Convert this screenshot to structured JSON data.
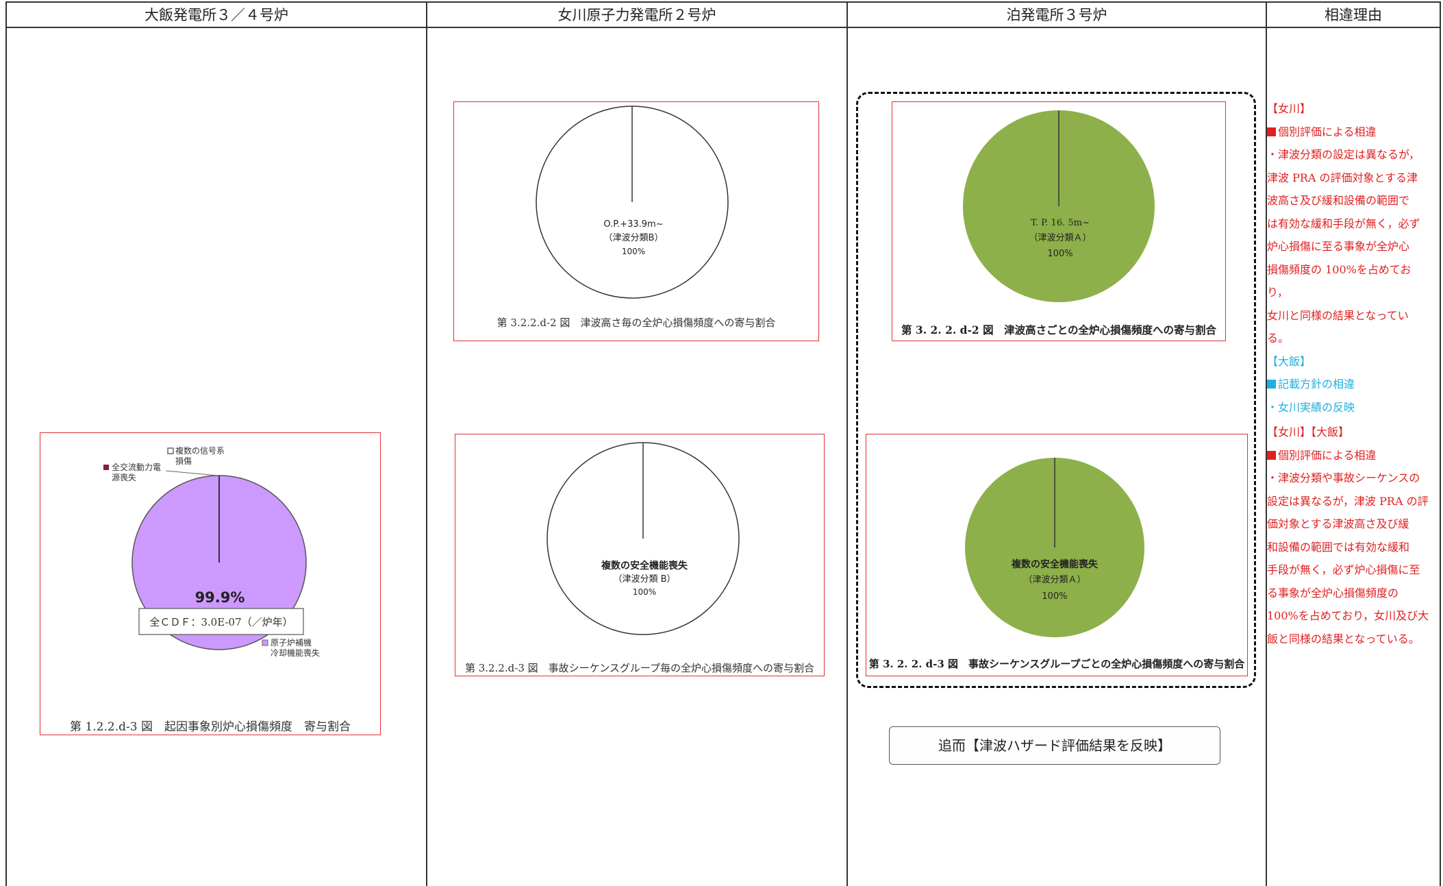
{
  "headers": {
    "col1": "大飯発電所３／４号炉",
    "col2": "女川原子力発電所２号炉",
    "col3": "泊発電所３号炉",
    "col4": "相違理由"
  },
  "ohi": {
    "legend_signal": "複数の信号系",
    "legend_signal2": "損傷",
    "legend_ac": "全交流動力電",
    "legend_ac2": "源喪失",
    "legend_rcs": "原子炉補機",
    "legend_rcs2": "冷却機能喪失",
    "pie_percent": "99.9%",
    "cdf_text": "全ＣＤＦ：3.0E-07（／炉年）",
    "caption": "第 1.2.2.d-3 図　起因事象別炉心損傷頻度　寄与割合",
    "pie_color": "#cc99ff",
    "legend_color_signal": "#999999",
    "legend_color_ac": "#7a2535",
    "legend_color_rcs": "#cc99ff"
  },
  "onagawa": {
    "pie1_line1": "O.P.+33.9m~",
    "pie1_line2": "（津波分類B）",
    "pie1_line3": "100%",
    "caption1": "第 3.2.2.d-2 図　津波高さ毎の全炉心損傷頻度への寄与割合",
    "pie2_line1": "複数の安全機能喪失",
    "pie2_line2": "（津波分類 B）",
    "pie2_line3": "100%",
    "caption2": "第 3.2.2.d-3 図　事故シーケンスグループ毎の全炉心損傷頻度への寄与割合"
  },
  "tomari": {
    "pie1_line1": "T. P. 16. 5m~",
    "pie1_line2": "（津波分類Ａ）",
    "pie1_line3": "100%",
    "caption1": "第 3. 2. 2. d-2 図　津波高さごとの全炉心損傷頻度への寄与割合",
    "pie2_line1": "複数の安全機能喪失",
    "pie2_line2": "（津波分類Ａ）",
    "pie2_line3": "100%",
    "caption2": "第 3. 2. 2. d-3 図　事故シーケンスグループごとの全炉心損傷頻度への寄与割合",
    "note": "追而【津波ハザード評価結果を反映】",
    "pie_color": "#8db04a"
  },
  "reasons": {
    "onagawa_tag": "【女川】",
    "item1_title": "個別評価による相違",
    "item1_lines": [
      "・津波分類の設定は異なるが，",
      "津波 PRA の評価対象とする津",
      "波高さ及び緩和設備の範囲で",
      "は有効な緩和手段が無く，必ず",
      "炉心損傷に至る事象が全炉心",
      "損傷頻度の 100%を占めており，",
      "女川と同様の結果となってい",
      "る。"
    ],
    "ohi_tag": "【大飯】",
    "item2_title": "記載方針の相違",
    "item2_line": "・女川実績の反映",
    "both_tag": "【女川】【大飯】",
    "item3_title": "個別評価による相違",
    "item3_lines": [
      "・津波分類や事故シーケンスの",
      "設定は異なるが，津波 PRA の評",
      "価対象とする津波高さ及び緩",
      "和設備の範囲では有効な緩和",
      "手段が無く，必ず炉心損傷に至",
      "る事象が全炉心損傷頻度の",
      "100%を占めており，女川及び大",
      "飯と同様の結果となっている。"
    ],
    "red_color": "#e02020",
    "cyan_color": "#1fb0e0"
  }
}
